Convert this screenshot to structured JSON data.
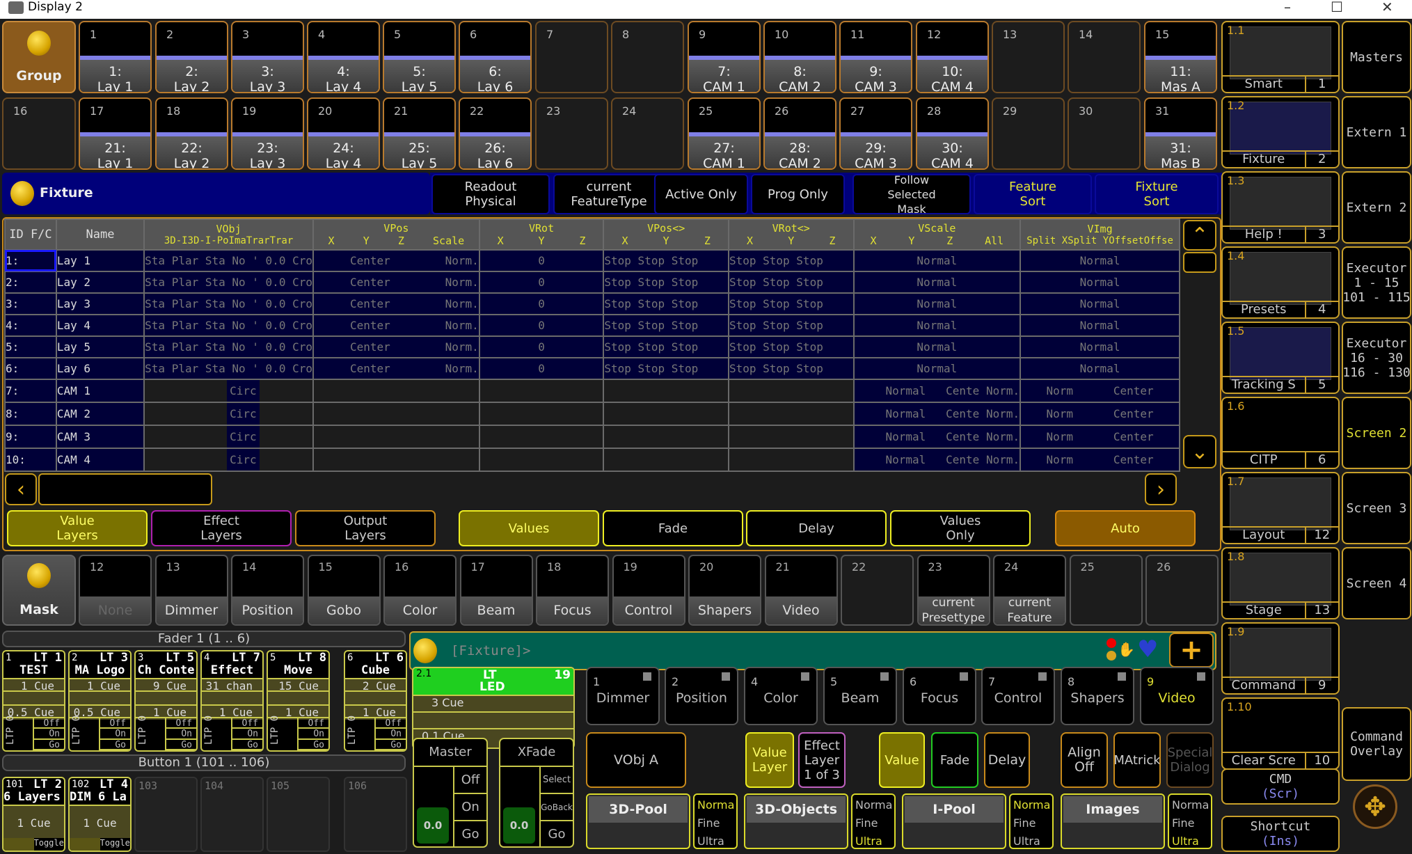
{
  "window": {
    "title": "Display 2",
    "controls": [
      "minimize",
      "maximize",
      "close"
    ]
  },
  "group_pool": {
    "label": "Group",
    "row1": [
      {
        "num": "1",
        "label": "1:\nLay 1"
      },
      {
        "num": "2",
        "label": "2:\nLay 2"
      },
      {
        "num": "3",
        "label": "3:\nLay 3"
      },
      {
        "num": "4",
        "label": "4:\nLay 4"
      },
      {
        "num": "5",
        "label": "5:\nLay 5"
      },
      {
        "num": "6",
        "label": "6:\nLay 6"
      },
      {
        "num": "7",
        "label": ""
      },
      {
        "num": "8",
        "label": ""
      },
      {
        "num": "9",
        "label": "7:\nCAM 1"
      },
      {
        "num": "10",
        "label": "8:\nCAM 2"
      },
      {
        "num": "11",
        "label": "9:\nCAM 3"
      },
      {
        "num": "12",
        "label": "10:\nCAM 4"
      },
      {
        "num": "13",
        "label": ""
      },
      {
        "num": "14",
        "label": ""
      },
      {
        "num": "15",
        "label": "11:\nMas A"
      }
    ],
    "row2": [
      {
        "num": "16",
        "label": ""
      },
      {
        "num": "17",
        "label": "21:\nLay 1"
      },
      {
        "num": "18",
        "label": "22:\nLay 2"
      },
      {
        "num": "19",
        "label": "23:\nLay 3"
      },
      {
        "num": "20",
        "label": "24:\nLay 4"
      },
      {
        "num": "21",
        "label": "25:\nLay 5"
      },
      {
        "num": "22",
        "label": "26:\nLay 6"
      },
      {
        "num": "23",
        "label": ""
      },
      {
        "num": "24",
        "label": ""
      },
      {
        "num": "25",
        "label": "27:\nCAM 1"
      },
      {
        "num": "26",
        "label": "28:\nCAM 2"
      },
      {
        "num": "27",
        "label": "29:\nCAM 3"
      },
      {
        "num": "28",
        "label": "30:\nCAM 4"
      },
      {
        "num": "29",
        "label": ""
      },
      {
        "num": "30",
        "label": ""
      },
      {
        "num": "31",
        "label": "31:\nMas B"
      }
    ]
  },
  "fixture_sheet": {
    "title": "Fixture",
    "toolbar": [
      {
        "label": "Readout\nPhysical"
      },
      {
        "label": "current\nFeatureType"
      },
      {
        "label": "Active Only"
      },
      {
        "label": "Prog Only"
      },
      {
        "label": "Follow\nSelected\nMask"
      },
      {
        "label": "Feature\nSort"
      },
      {
        "label": "Fixture\nSort"
      }
    ],
    "headers": {
      "id": "ID F/C",
      "name": "Name",
      "vobj": "VObj",
      "vobj_sub": "3D-I3D-I-PoImaTrarTrar",
      "vpos": "VPos",
      "vpos_sub": [
        "X",
        "Y",
        "Z",
        "Scale"
      ],
      "vrot": "VRot",
      "vrot_sub": [
        "X",
        "Y",
        "Z"
      ],
      "vposd": "VPos<>",
      "vposd_sub": [
        "X",
        "Y",
        "Z"
      ],
      "vrotd": "VRot<>",
      "vrotd_sub": [
        "X",
        "Y",
        "Z"
      ],
      "vscale": "VScale",
      "vscale_sub": [
        "X",
        "Y",
        "Z",
        "All"
      ],
      "vimg": "VImg",
      "vimg_sub": "Split XSplit YOffsetOffse"
    },
    "rows": [
      {
        "id": "1:",
        "name": "Lay 1",
        "vobj": "Sta Plar Sta No ' 0.0 Cro",
        "vpos": "Center",
        "scale": "Norm.",
        "vrot": "0",
        "vposd": "Stop  Stop  Stop",
        "vrotd": "Stop  Stop  Stop",
        "vscale": "Normal",
        "vimg": "Normal"
      },
      {
        "id": "2:",
        "name": "Lay 2",
        "vobj": "Sta Plar Sta No ' 0.0 Cro",
        "vpos": "Center",
        "scale": "Norm.",
        "vrot": "0",
        "vposd": "Stop  Stop  Stop",
        "vrotd": "Stop  Stop  Stop",
        "vscale": "Normal",
        "vimg": "Normal"
      },
      {
        "id": "3:",
        "name": "Lay 3",
        "vobj": "Sta Plar Sta No ' 0.0 Cro",
        "vpos": "Center",
        "scale": "Norm.",
        "vrot": "0",
        "vposd": "Stop  Stop  Stop",
        "vrotd": "Stop  Stop  Stop",
        "vscale": "Normal",
        "vimg": "Normal"
      },
      {
        "id": "4:",
        "name": "Lay 4",
        "vobj": "Sta Plar Sta No ' 0.0 Cro",
        "vpos": "Center",
        "scale": "Norm.",
        "vrot": "0",
        "vposd": "Stop  Stop  Stop",
        "vrotd": "Stop  Stop  Stop",
        "vscale": "Normal",
        "vimg": "Normal"
      },
      {
        "id": "5:",
        "name": "Lay 5",
        "vobj": "Sta Plar Sta No ' 0.0 Cro",
        "vpos": "Center",
        "scale": "Norm.",
        "vrot": "0",
        "vposd": "Stop  Stop  Stop",
        "vrotd": "Stop  Stop  Stop",
        "vscale": "Normal",
        "vimg": "Normal"
      },
      {
        "id": "6:",
        "name": "Lay 6",
        "vobj": "Sta Plar Sta No ' 0.0 Cro",
        "vpos": "Center",
        "scale": "Norm.",
        "vrot": "0",
        "vposd": "Stop  Stop  Stop",
        "vrotd": "Stop  Stop  Stop",
        "vscale": "Normal",
        "vimg": "Normal"
      },
      {
        "id": "7:",
        "name": "CAM 1",
        "vobj": "Circ",
        "vscale": "Normal   Cente Norm.",
        "vimg": "Norm      Center"
      },
      {
        "id": "8:",
        "name": "CAM 2",
        "vobj": "Circ",
        "vscale": "Normal   Cente Norm.",
        "vimg": "Norm      Center"
      },
      {
        "id": "9:",
        "name": "CAM 3",
        "vobj": "Circ",
        "vscale": "Normal   Cente Norm.",
        "vimg": "Norm      Center"
      },
      {
        "id": "10:",
        "name": "CAM 4",
        "vobj": "Circ",
        "vscale": "Normal   Cente Norm.",
        "vimg": "Norm      Center"
      }
    ],
    "layer_buttons": [
      {
        "label": "Value\nLayers",
        "active": true
      },
      {
        "label": "Effect\nLayers",
        "active": false
      },
      {
        "label": "Output\nLayers",
        "active": false
      }
    ],
    "value_buttons": [
      {
        "label": "Values",
        "active": true
      },
      {
        "label": "Fade"
      },
      {
        "label": "Delay"
      },
      {
        "label": "Values\nOnly"
      }
    ],
    "auto_label": "Auto"
  },
  "mask_pool": {
    "label": "Mask",
    "items": [
      {
        "num": "12",
        "label": "None"
      },
      {
        "num": "13",
        "label": "Dimmer"
      },
      {
        "num": "14",
        "label": "Position"
      },
      {
        "num": "15",
        "label": "Gobo"
      },
      {
        "num": "16",
        "label": "Color"
      },
      {
        "num": "17",
        "label": "Beam"
      },
      {
        "num": "18",
        "label": "Focus"
      },
      {
        "num": "19",
        "label": "Control"
      },
      {
        "num": "20",
        "label": "Shapers"
      },
      {
        "num": "21",
        "label": "Video"
      },
      {
        "num": "22",
        "label": ""
      },
      {
        "num": "23",
        "label": "current\nPresettype"
      },
      {
        "num": "24",
        "label": "current\nFeature"
      },
      {
        "num": "25",
        "label": ""
      },
      {
        "num": "26",
        "label": ""
      }
    ]
  },
  "fader_bar": {
    "title": "Fader  1 (1 .. 6)",
    "executors": [
      {
        "num": "1",
        "lt": "LT  1",
        "name": "TEST",
        "cue": "1 Cue",
        "fade": "0.5 Cue"
      },
      {
        "num": "2",
        "lt": "LT  3",
        "name": "MA Logo",
        "cue": "1 Cue",
        "fade": "0.5 Cue"
      },
      {
        "num": "3",
        "lt": "LT  5",
        "name": "Ch Conte",
        "cue": "9 Cue",
        "fade": "1 Cue"
      },
      {
        "num": "4",
        "lt": "LT  7",
        "name": "Effect",
        "cue": "31 chan",
        "fade": "1 Cue"
      },
      {
        "num": "5",
        "lt": "LT  8",
        "name": "Move",
        "cue": "15 Cue",
        "fade": "1 Cue"
      },
      {
        "num": "6",
        "lt": "LT  6",
        "name": "Cube",
        "cue": "2 Cue",
        "fade": "1 Cue"
      }
    ],
    "controls": {
      "ltp": "LTP",
      "ltp_val": "0",
      "off": "Off",
      "on": "On",
      "go": "Go"
    }
  },
  "button_bar": {
    "title": "Button  1 (101 .. 106)",
    "executors": [
      {
        "num": "101",
        "lt": "LT  2",
        "name": "6 Layers",
        "cue": "1 Cue",
        "toggle": "Toggle"
      },
      {
        "num": "102",
        "lt": "LT  4",
        "name": "DIM 6 La",
        "cue": "1 Cue",
        "toggle": "Toggle"
      },
      {
        "num": "103"
      },
      {
        "num": "104"
      },
      {
        "num": "105"
      },
      {
        "num": "106"
      }
    ]
  },
  "command_line": {
    "prompt": "[Fixture]>",
    "add_label": "+"
  },
  "main_executor": {
    "num": "2.1",
    "lt": "LT",
    "name": "LED",
    "page": "19",
    "cue": "3 Cue",
    "fade": "0.1 Cue"
  },
  "master": {
    "title": "Master",
    "value": "0.0 %",
    "off": "Off",
    "on": "On",
    "go": "Go"
  },
  "xfade": {
    "title": "XFade",
    "value": "0.0 %",
    "select": "Select",
    "goback": "GoBack",
    "go": "Go"
  },
  "feature_buttons": [
    {
      "num": "1",
      "label": "Dimmer"
    },
    {
      "num": "2",
      "label": "Position"
    },
    {
      "num": "4",
      "label": "Color"
    },
    {
      "num": "5",
      "label": "Beam"
    },
    {
      "num": "6",
      "label": "Focus"
    },
    {
      "num": "7",
      "label": "Control"
    },
    {
      "num": "8",
      "label": "Shapers"
    },
    {
      "num": "9",
      "label": "Video",
      "active": true
    }
  ],
  "encoder_toolbar": {
    "vobj": "VObj A",
    "value_layer": "Value\nLayer",
    "effect_layer": "Effect\nLayer\n1 of 3",
    "value": "Value",
    "fade": "Fade",
    "delay": "Delay",
    "align": "Align\nOff",
    "matricks": "MAtrick",
    "special": "Special\nDialog"
  },
  "encoders": [
    {
      "label": "3D-Pool",
      "res": [
        "Norma",
        "Fine",
        "Ultra"
      ],
      "res_active": 0
    },
    {
      "label": "3D-Objects",
      "res": [
        "Norma",
        "Fine",
        "Ultra"
      ],
      "res_active": 2
    },
    {
      "label": "I-Pool",
      "res": [
        "Norma",
        "Fine",
        "Ultra"
      ],
      "res_active": 0
    },
    {
      "label": "Images",
      "res": [
        "Norma",
        "Fine",
        "Ultra"
      ],
      "res_active": 2
    }
  ],
  "view_pool": [
    {
      "id": "1.1",
      "name": "Smart",
      "num": "1"
    },
    {
      "id": "1.2",
      "name": "Fixture",
      "num": "2"
    },
    {
      "id": "1.3",
      "name": "Help !",
      "num": "3"
    },
    {
      "id": "1.4",
      "name": "Presets",
      "num": "4"
    },
    {
      "id": "1.5",
      "name": "Tracking S",
      "num": "5"
    },
    {
      "id": "1.6",
      "name": "CITP",
      "num": "6"
    },
    {
      "id": "1.7",
      "name": "Layout",
      "num": "12"
    },
    {
      "id": "1.8",
      "name": "Stage",
      "num": "13"
    },
    {
      "id": "1.9",
      "name": "Command",
      "num": "9"
    },
    {
      "id": "1.10",
      "name": "Clear Scre",
      "num": "10"
    }
  ],
  "screen_buttons": [
    {
      "label": "Masters"
    },
    {
      "label": "Extern 1"
    },
    {
      "label": "Extern 2"
    },
    {
      "label": "Executor\n1 - 15\n101 - 115"
    },
    {
      "label": "Executor\n16 - 30\n116 - 130"
    },
    {
      "label": "Screen 2",
      "active": true
    },
    {
      "label": "Screen 3"
    },
    {
      "label": "Screen 4"
    },
    {
      "label": "Command\nOverlay"
    }
  ],
  "bottom_right": {
    "cmd": "CMD",
    "cmd_key": "(Scr)",
    "shortcut": "Shortcut",
    "shortcut_key": "(Ins)"
  },
  "colors": {
    "accent": "#c9a02a",
    "blue_panel": "#00007a",
    "active_yellow": "#7a7200",
    "green": "#1fcf1f",
    "teal": "#006050"
  }
}
